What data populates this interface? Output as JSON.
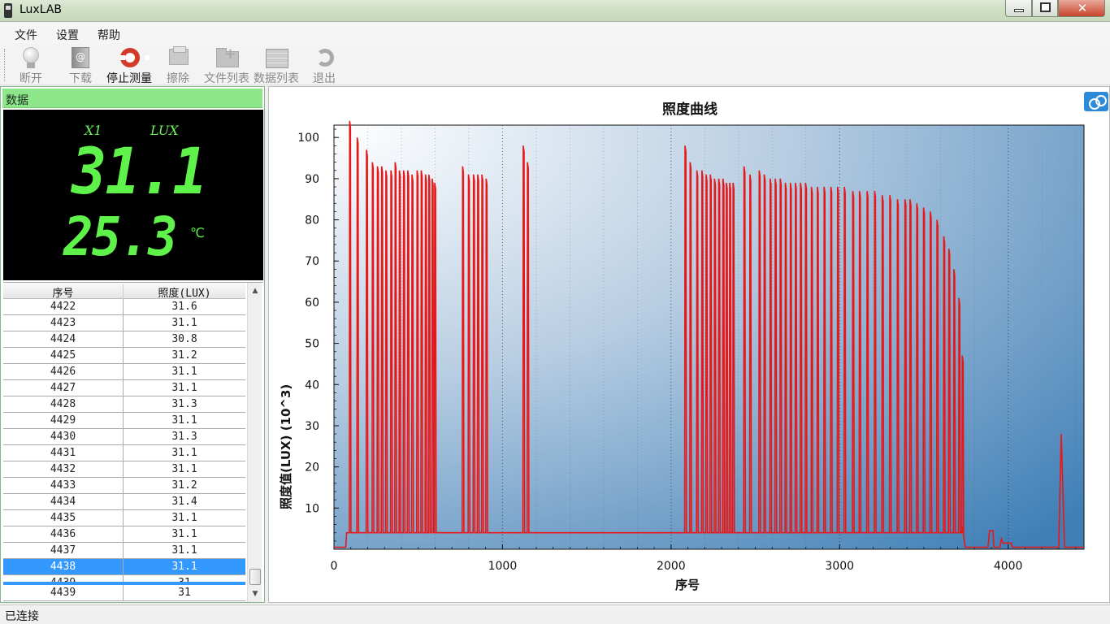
{
  "window": {
    "title": "LuxLAB"
  },
  "menu": [
    "文件",
    "设置",
    "帮助"
  ],
  "toolbar": [
    {
      "label": "断开",
      "icon": "bulb-icon",
      "enabled": false
    },
    {
      "label": "下载",
      "icon": "book-icon",
      "enabled": false
    },
    {
      "label": "停止测量",
      "icon": "lifebuoy-icon",
      "enabled": true
    },
    {
      "label": "擦除",
      "icon": "printer-icon",
      "enabled": false
    },
    {
      "label": "文件列表",
      "icon": "folder-add-icon",
      "enabled": false
    },
    {
      "label": "数据列表",
      "icon": "table-icon",
      "enabled": false
    },
    {
      "label": "退出",
      "icon": "exit-icon",
      "enabled": false
    }
  ],
  "panel": {
    "title": "数据",
    "lcd": {
      "channel": "X1",
      "unit": "LUX",
      "lux": "31.1",
      "temperature": "25.3",
      "temp_unit": "℃"
    },
    "table": {
      "headers": [
        "序号",
        "照度(LUX)"
      ],
      "rows": [
        [
          "4422",
          "31.6"
        ],
        [
          "4423",
          "31.1"
        ],
        [
          "4424",
          "30.8"
        ],
        [
          "4425",
          "31.2"
        ],
        [
          "4426",
          "31.1"
        ],
        [
          "4427",
          "31.1"
        ],
        [
          "4428",
          "31.3"
        ],
        [
          "4429",
          "31.1"
        ],
        [
          "4430",
          "31.3"
        ],
        [
          "4431",
          "31.1"
        ],
        [
          "4432",
          "31.1"
        ],
        [
          "4433",
          "31.2"
        ],
        [
          "4434",
          "31.4"
        ],
        [
          "4435",
          "31.1"
        ],
        [
          "4436",
          "31.1"
        ],
        [
          "4437",
          "31.1"
        ],
        [
          "4438",
          "31.1"
        ],
        [
          "4439",
          "31"
        ],
        [
          "4439",
          "31"
        ]
      ],
      "selected_row_index": 16
    }
  },
  "chart_data": {
    "type": "line",
    "title": "照度曲线",
    "xlabel": "序号",
    "ylabel": "照度值(LUX)  (10^3)",
    "xlim": [
      0,
      4450
    ],
    "ylim": [
      0,
      103
    ],
    "xticks": [
      0,
      1000,
      2000,
      3000,
      4000
    ],
    "yticks": [
      10,
      20,
      30,
      40,
      50,
      60,
      70,
      80,
      90,
      100
    ],
    "grid": "vertical dotted",
    "series_color": "#e81818",
    "baseline": 4,
    "pulses": [
      [
        95,
        104
      ],
      [
        140,
        100
      ],
      [
        195,
        97
      ],
      [
        230,
        94
      ],
      [
        260,
        93
      ],
      [
        285,
        93
      ],
      [
        310,
        92
      ],
      [
        340,
        92
      ],
      [
        365,
        94
      ],
      [
        390,
        92
      ],
      [
        415,
        92
      ],
      [
        440,
        92
      ],
      [
        465,
        91
      ],
      [
        495,
        92
      ],
      [
        520,
        92
      ],
      [
        545,
        91
      ],
      [
        565,
        91
      ],
      [
        585,
        90
      ],
      [
        600,
        89
      ],
      [
        765,
        93
      ],
      [
        800,
        91
      ],
      [
        830,
        91
      ],
      [
        855,
        91
      ],
      [
        880,
        91
      ],
      [
        905,
        90
      ],
      [
        1125,
        98
      ],
      [
        1150,
        94
      ],
      [
        2085,
        98
      ],
      [
        2115,
        94
      ],
      [
        2155,
        92
      ],
      [
        2185,
        92
      ],
      [
        2210,
        91
      ],
      [
        2235,
        91
      ],
      [
        2260,
        90
      ],
      [
        2285,
        90
      ],
      [
        2310,
        90
      ],
      [
        2330,
        89
      ],
      [
        2350,
        89
      ],
      [
        2370,
        89
      ],
      [
        2435,
        93
      ],
      [
        2470,
        91
      ],
      [
        2525,
        92
      ],
      [
        2555,
        91
      ],
      [
        2590,
        90
      ],
      [
        2620,
        90
      ],
      [
        2650,
        90
      ],
      [
        2680,
        89
      ],
      [
        2710,
        89
      ],
      [
        2740,
        89
      ],
      [
        2770,
        89
      ],
      [
        2800,
        89
      ],
      [
        2835,
        88
      ],
      [
        2870,
        88
      ],
      [
        2910,
        88
      ],
      [
        2950,
        88
      ],
      [
        2990,
        88
      ],
      [
        3030,
        88
      ],
      [
        3080,
        87
      ],
      [
        3120,
        87
      ],
      [
        3165,
        87
      ],
      [
        3210,
        87
      ],
      [
        3255,
        86
      ],
      [
        3300,
        86
      ],
      [
        3345,
        85
      ],
      [
        3390,
        85
      ],
      [
        3420,
        85
      ],
      [
        3460,
        84
      ],
      [
        3500,
        83
      ],
      [
        3540,
        82
      ],
      [
        3580,
        80
      ],
      [
        3620,
        76
      ],
      [
        3650,
        73
      ],
      [
        3680,
        68
      ],
      [
        3710,
        61
      ],
      [
        3730,
        47
      ]
    ],
    "tail": [
      [
        3730,
        5
      ],
      [
        3745,
        0.5
      ],
      [
        3880,
        0.5
      ],
      [
        3890,
        4.5
      ],
      [
        3910,
        4.5
      ],
      [
        3915,
        0.5
      ],
      [
        3950,
        0.5
      ],
      [
        3960,
        2.5
      ],
      [
        3970,
        1.5
      ],
      [
        4020,
        1.5
      ],
      [
        4025,
        0.5
      ],
      [
        4300,
        0.5
      ],
      [
        4315,
        28
      ],
      [
        4335,
        0.5
      ],
      [
        4450,
        0.5
      ]
    ]
  },
  "status": {
    "text": "已连接"
  }
}
